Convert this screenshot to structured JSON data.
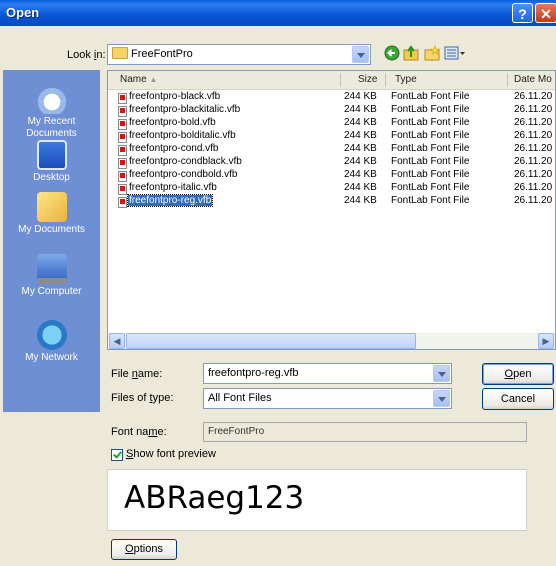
{
  "window": {
    "title": "Open"
  },
  "look_in": {
    "label_prefix": "Look ",
    "label_key": "i",
    "label_suffix": "n:",
    "value": "FreeFontPro"
  },
  "places": [
    {
      "label_line1": "My Recent",
      "label_line2": "Documents"
    },
    {
      "label_line1": "Desktop",
      "label_line2": ""
    },
    {
      "label_line1": "My Documents",
      "label_line2": ""
    },
    {
      "label_line1": "My Computer",
      "label_line2": ""
    },
    {
      "label_line1": "My Network",
      "label_line2": ""
    }
  ],
  "columns": {
    "name": "Name",
    "sort": "▲",
    "size": "Size",
    "type": "Type",
    "date": "Date Mo"
  },
  "files": [
    {
      "name": "freefontpro-black.vfb",
      "size": "244 KB",
      "type": "FontLab Font File",
      "date": "26.11.20"
    },
    {
      "name": "freefontpro-blackitalic.vfb",
      "size": "244 KB",
      "type": "FontLab Font File",
      "date": "26.11.20"
    },
    {
      "name": "freefontpro-bold.vfb",
      "size": "244 KB",
      "type": "FontLab Font File",
      "date": "26.11.20"
    },
    {
      "name": "freefontpro-bolditalic.vfb",
      "size": "244 KB",
      "type": "FontLab Font File",
      "date": "26.11.20"
    },
    {
      "name": "freefontpro-cond.vfb",
      "size": "244 KB",
      "type": "FontLab Font File",
      "date": "26.11.20"
    },
    {
      "name": "freefontpro-condblack.vfb",
      "size": "244 KB",
      "type": "FontLab Font File",
      "date": "26.11.20"
    },
    {
      "name": "freefontpro-condbold.vfb",
      "size": "244 KB",
      "type": "FontLab Font File",
      "date": "26.11.20"
    },
    {
      "name": "freefontpro-italic.vfb",
      "size": "244 KB",
      "type": "FontLab Font File",
      "date": "26.11.20"
    },
    {
      "name": "freefontpro-reg.vfb",
      "size": "244 KB",
      "type": "FontLab Font File",
      "date": "26.11.20"
    }
  ],
  "file_name": {
    "label_pre": "File ",
    "label_key": "n",
    "label_post": "ame:",
    "value": "freefontpro-reg.vfb"
  },
  "file_type": {
    "label_pre": "Files of ",
    "label_key": "t",
    "label_post": "ype:",
    "value": "All Font Files"
  },
  "buttons": {
    "open_key": "O",
    "open_rest": "pen",
    "cancel": "Cancel",
    "options_key": "O",
    "options_rest": "ptions"
  },
  "font_name": {
    "label_pre": "Font na",
    "label_key": "m",
    "label_post": "e:",
    "value": "FreeFontPro"
  },
  "show_preview": {
    "label_pre": "",
    "label_key": "S",
    "label_post": "how font preview"
  },
  "preview_text": "ABRaeg123"
}
